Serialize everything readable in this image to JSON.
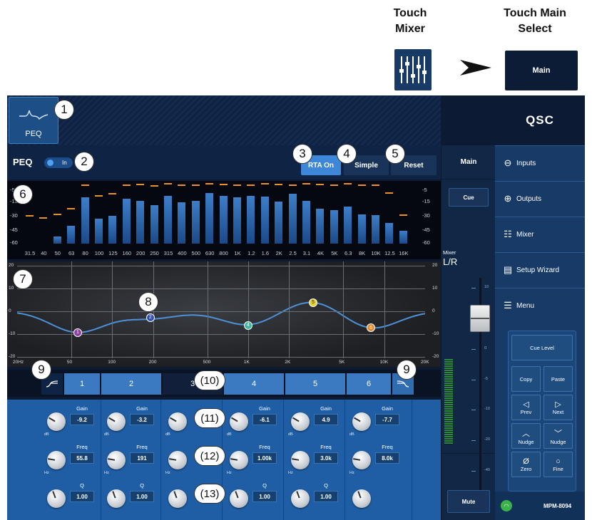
{
  "header": {
    "touch_mixer_line1": "Touch",
    "touch_mixer_line2": "Mixer",
    "touch_main_line1": "Touch Main",
    "touch_main_line2": "Select",
    "main_button_label": "Main"
  },
  "callouts": [
    "1",
    "2",
    "3",
    "4",
    "5",
    "6",
    "7",
    "8",
    "9",
    "(10)",
    "(11)",
    "(12)",
    "(13)"
  ],
  "peq": {
    "tab_label": "PEQ",
    "title": "PEQ",
    "toggle_label": "In",
    "toggle_on": true,
    "rta_button": "RTA On",
    "simple_button": "Simple",
    "reset_button": "Reset"
  },
  "rta": {
    "y_labels_left": [
      "-5",
      "-15",
      "-30",
      "-45",
      "-60"
    ],
    "y_labels_right": [
      "-5",
      "-15",
      "-30",
      "-45",
      "-60"
    ],
    "freq_labels": [
      "31.5",
      "40",
      "50",
      "63",
      "80",
      "100",
      "125",
      "160",
      "200",
      "250",
      "315",
      "400",
      "500",
      "630",
      "800",
      "1K",
      "1.2",
      "1.6",
      "2K",
      "2.5",
      "3.1",
      "4K",
      "5K",
      "6.3",
      "8K",
      "10K",
      "12.5",
      "16K"
    ],
    "levels": [
      0,
      0,
      0.12,
      0.3,
      0.77,
      0.42,
      0.47,
      0.75,
      0.71,
      0.64,
      0.8,
      0.69,
      0.71,
      0.84,
      0.8,
      0.77,
      0.8,
      0.79,
      0.7,
      0.83,
      0.71,
      0.58,
      0.56,
      0.62,
      0.49,
      0.48,
      0.34,
      0.22
    ],
    "peaks": [
      0.45,
      0.42,
      0.48,
      0.57,
      0.96,
      0.78,
      0.82,
      0.97,
      0.98,
      0.95,
      0.99,
      0.96,
      0.97,
      0.99,
      0.98,
      0.96,
      0.97,
      0.99,
      0.98,
      0.97,
      0.99,
      0.98,
      0.97,
      0.99,
      0.97,
      0.96,
      0.83,
      0.46
    ]
  },
  "eq": {
    "y_labels": [
      "20",
      "10",
      "0",
      "-10",
      "-20"
    ],
    "x_labels": [
      "20Hz",
      "50",
      "100",
      "200",
      "500",
      "1K",
      "2K",
      "5K",
      "10K",
      "20K"
    ],
    "nodes": [
      {
        "label": "1",
        "freq": 55.8,
        "gain": -9.2,
        "color": "#8e3fa0"
      },
      {
        "label": "2",
        "freq": 191,
        "gain": -3.2,
        "color": "#3250b8"
      },
      {
        "label": "4",
        "freq": 1000,
        "gain": -6.1,
        "color": "#3fb6a2"
      },
      {
        "label": "5",
        "freq": 3000,
        "gain": 4.9,
        "color": "#e6d22e"
      },
      {
        "label": "6",
        "freq": 8000,
        "gain": -7.7,
        "color": "#e6892e"
      }
    ]
  },
  "bands": {
    "items": [
      "1",
      "2",
      "3",
      "4",
      "5",
      "6"
    ],
    "hpf_icon": "high-pass-icon",
    "lpf_icon": "low-pass-icon"
  },
  "bandparams": [
    {
      "gain": "-9.2",
      "freq": "55.8",
      "q": "1.00"
    },
    {
      "gain": "-3.2",
      "freq": "191",
      "q": "1.00"
    },
    {
      "gain": "",
      "freq": "",
      "q": ""
    },
    {
      "gain": "-6.1",
      "freq": "1.00k",
      "q": "1.00"
    },
    {
      "gain": "4.9",
      "freq": "3.0k",
      "q": "1.00"
    },
    {
      "gain": "-7.7",
      "freq": "8.0k",
      "q": ""
    }
  ],
  "param_labels": {
    "gain": "Gain",
    "freq": "Freq",
    "q": "Q",
    "db": "dB",
    "hz": "Hz"
  },
  "mixcol": {
    "main_label": "Main",
    "cue_label": "Cue",
    "mixer_label": "Mixer",
    "lr_label": "L/R",
    "mute_label": "Mute",
    "fader_scale": [
      "10",
      "5",
      "0",
      "-5",
      "-10",
      "-20",
      "-40",
      "-60"
    ],
    "fader_level": 0.72
  },
  "side": {
    "brand": "QSC",
    "nav": [
      {
        "label": "Inputs",
        "icon": "input-icon"
      },
      {
        "label": "Outputs",
        "icon": "output-icon"
      },
      {
        "label": "Mixer",
        "icon": "faders-icon"
      },
      {
        "label": "Setup Wizard",
        "icon": "clipboard-icon"
      },
      {
        "label": "Menu",
        "icon": "menu-icon"
      }
    ],
    "cue_level": "Cue Level",
    "copy": "Copy",
    "paste": "Paste",
    "prev": "Prev",
    "next": "Next",
    "nudge_up": "Nudge",
    "nudge_down": "Nudge",
    "zero": "Zero",
    "fine": "Fine",
    "device": "MPM-8094"
  }
}
